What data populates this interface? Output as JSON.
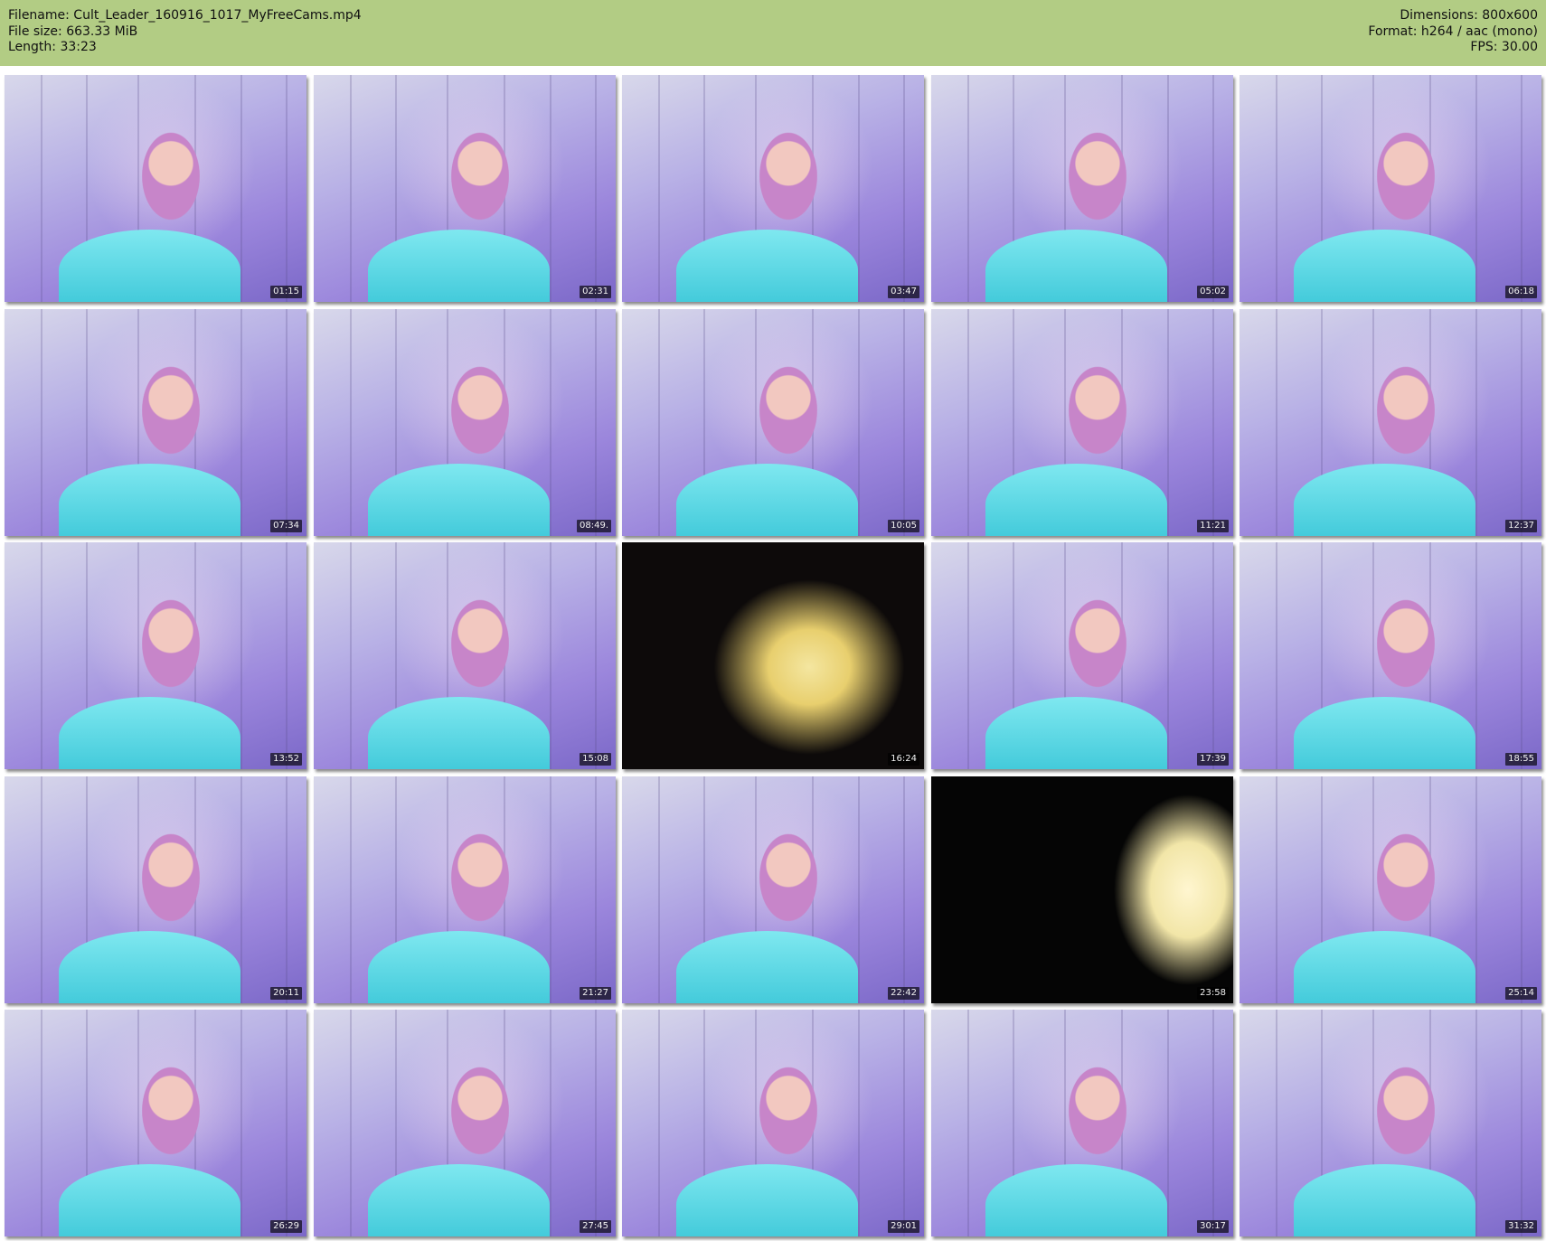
{
  "header": {
    "left": [
      "Filename: Cult_Leader_160916_1017_MyFreeCams.mp4",
      "File size: 663.33 MiB",
      "Length: 33:23"
    ],
    "right": [
      "Dimensions: 800x600",
      "Format: h264 / aac (mono)",
      "FPS: 30.00"
    ]
  },
  "thumbnails": [
    {
      "time": "01:15",
      "kind": "webcam"
    },
    {
      "time": "02:31",
      "kind": "webcam"
    },
    {
      "time": "03:47",
      "kind": "webcam"
    },
    {
      "time": "05:02",
      "kind": "webcam"
    },
    {
      "time": "06:18",
      "kind": "webcam"
    },
    {
      "time": "07:34",
      "kind": "webcam"
    },
    {
      "time": "08:49.",
      "kind": "webcam"
    },
    {
      "time": "10:05",
      "kind": "webcam"
    },
    {
      "time": "11:21",
      "kind": "webcam"
    },
    {
      "time": "12:37",
      "kind": "webcam"
    },
    {
      "time": "13:52",
      "kind": "webcam"
    },
    {
      "time": "15:08",
      "kind": "webcam"
    },
    {
      "time": "16:24",
      "kind": "screen-photo"
    },
    {
      "time": "17:39",
      "kind": "webcam"
    },
    {
      "time": "18:55",
      "kind": "webcam"
    },
    {
      "time": "20:11",
      "kind": "webcam"
    },
    {
      "time": "21:27",
      "kind": "webcam"
    },
    {
      "time": "22:42",
      "kind": "webcam"
    },
    {
      "time": "23:58",
      "kind": "phone-screen"
    },
    {
      "time": "25:14",
      "kind": "webcam"
    },
    {
      "time": "26:29",
      "kind": "webcam"
    },
    {
      "time": "27:45",
      "kind": "webcam"
    },
    {
      "time": "29:01",
      "kind": "webcam"
    },
    {
      "time": "30:17",
      "kind": "webcam"
    },
    {
      "time": "31:32",
      "kind": "webcam"
    }
  ]
}
